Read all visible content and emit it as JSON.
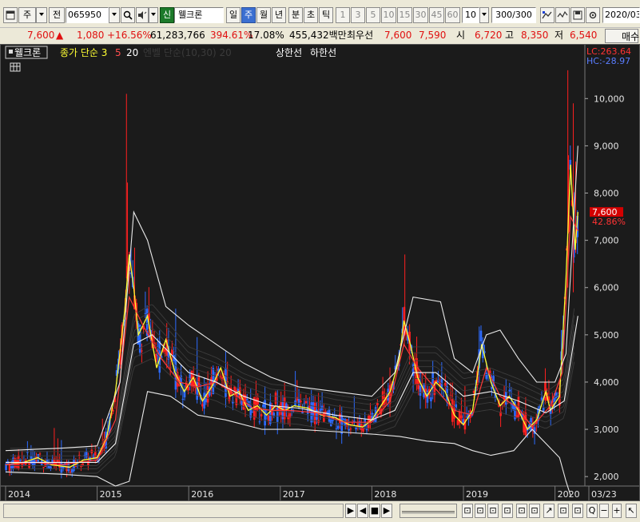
{
  "toolbar": {
    "market_label": "주",
    "prev_label": "전",
    "code": "065950",
    "stock_badge": "신",
    "stock_name": "웰크론",
    "period_day": "일",
    "period_week": "주",
    "period_month": "월",
    "period_year": "년",
    "period_minute": "분",
    "period_second": "초",
    "period_tick": "틱",
    "nums": [
      "1",
      "3",
      "5",
      "10",
      "15",
      "30",
      "45",
      "60"
    ],
    "interval": "10",
    "count": "300/300",
    "date": "2020/03"
  },
  "price": {
    "current": "7,600",
    "change_arrow": "▲",
    "change": "1,080",
    "change_pct": "+16.56%",
    "volume": "61,283,766",
    "volume_ratio": "394.61%",
    "turnover_pct": "17.08%",
    "amount": "455,432백만",
    "best_label": "최우선",
    "best_ask": "7,600",
    "best_bid": "7,590",
    "open_label": "시",
    "open": "6,720",
    "high_label": "고",
    "high": "8,350",
    "low_label": "저",
    "low": "6,540",
    "buy_label": "매수"
  },
  "legend": {
    "stock_name": "웰크론",
    "ma_label": "종가 단순 3",
    "ma_5": "5",
    "ma_20": "20",
    "faded": "엔벨 단순(10,30) 20",
    "upper_limit": "상한선",
    "lower_limit": "하한선"
  },
  "chart_data": {
    "type": "line",
    "title": "",
    "xlabel": "",
    "ylabel": "",
    "y_axis_ticks": [
      "10,000",
      "9,000",
      "8,000",
      "7,000",
      "6,000",
      "5,000",
      "4,000",
      "3,000",
      "2,000"
    ],
    "ylim": [
      1800,
      10800
    ],
    "x_axis_labels": [
      "2014",
      "2015",
      "2016",
      "2017",
      "2018",
      "2019",
      "2020",
      "03/23"
    ],
    "lc_label": "LC:263.64",
    "hc_label": "HC:-28.97",
    "current_price_label": "7,600",
    "current_pct_label": "42.86%",
    "series": [
      {
        "name": "종가 단순 3",
        "values": [
          [
            2014.0,
            2250
          ],
          [
            2014.2,
            2300
          ],
          [
            2014.35,
            2400
          ],
          [
            2014.5,
            2250
          ],
          [
            2014.7,
            2200
          ],
          [
            2014.85,
            2350
          ],
          [
            2015.0,
            2400
          ],
          [
            2015.1,
            2800
          ],
          [
            2015.2,
            3800
          ],
          [
            2015.3,
            5500
          ],
          [
            2015.35,
            6700
          ],
          [
            2015.4,
            6000
          ],
          [
            2015.45,
            5000
          ],
          [
            2015.55,
            5400
          ],
          [
            2015.65,
            4300
          ],
          [
            2015.75,
            4900
          ],
          [
            2015.85,
            4200
          ],
          [
            2015.95,
            3800
          ],
          [
            2016.05,
            4100
          ],
          [
            2016.15,
            3600
          ],
          [
            2016.25,
            3900
          ],
          [
            2016.35,
            4300
          ],
          [
            2016.45,
            3700
          ],
          [
            2016.55,
            3800
          ],
          [
            2016.65,
            3400
          ],
          [
            2016.75,
            3500
          ],
          [
            2016.85,
            3300
          ],
          [
            2016.95,
            3500
          ],
          [
            2017.05,
            3400
          ],
          [
            2017.15,
            3500
          ],
          [
            2017.3,
            3450
          ],
          [
            2017.45,
            3300
          ],
          [
            2017.6,
            3250
          ],
          [
            2017.75,
            3100
          ],
          [
            2017.9,
            3050
          ],
          [
            2018.0,
            3200
          ],
          [
            2018.1,
            3500
          ],
          [
            2018.2,
            3800
          ],
          [
            2018.3,
            4500
          ],
          [
            2018.35,
            5300
          ],
          [
            2018.42,
            4800
          ],
          [
            2018.5,
            4100
          ],
          [
            2018.6,
            3700
          ],
          [
            2018.7,
            4000
          ],
          [
            2018.8,
            3800
          ],
          [
            2018.9,
            3300
          ],
          [
            2019.0,
            3100
          ],
          [
            2019.1,
            3400
          ],
          [
            2019.2,
            4800
          ],
          [
            2019.3,
            4000
          ],
          [
            2019.4,
            3500
          ],
          [
            2019.5,
            3700
          ],
          [
            2019.6,
            3400
          ],
          [
            2019.7,
            3000
          ],
          [
            2019.8,
            3200
          ],
          [
            2019.9,
            3800
          ],
          [
            2019.95,
            3400
          ],
          [
            2020.05,
            3700
          ],
          [
            2020.12,
            6200
          ],
          [
            2020.17,
            8600
          ],
          [
            2020.22,
            6800
          ],
          [
            2020.25,
            7600
          ]
        ]
      },
      {
        "name": "5",
        "values": [
          [
            2014.0,
            2250
          ],
          [
            2014.3,
            2300
          ],
          [
            2014.6,
            2250
          ],
          [
            2015.0,
            2350
          ],
          [
            2015.2,
            3200
          ],
          [
            2015.35,
            5800
          ],
          [
            2015.5,
            5200
          ],
          [
            2015.7,
            4500
          ],
          [
            2015.9,
            4000
          ],
          [
            2016.1,
            3900
          ],
          [
            2016.3,
            4000
          ],
          [
            2016.5,
            3750
          ],
          [
            2016.7,
            3450
          ],
          [
            2016.9,
            3400
          ],
          [
            2017.1,
            3400
          ],
          [
            2017.4,
            3350
          ],
          [
            2017.7,
            3150
          ],
          [
            2018.0,
            3150
          ],
          [
            2018.2,
            3600
          ],
          [
            2018.35,
            4800
          ],
          [
            2018.5,
            4300
          ],
          [
            2018.7,
            3850
          ],
          [
            2018.9,
            3400
          ],
          [
            2019.1,
            3300
          ],
          [
            2019.25,
            4300
          ],
          [
            2019.4,
            3700
          ],
          [
            2019.6,
            3450
          ],
          [
            2019.75,
            3050
          ],
          [
            2019.95,
            3500
          ],
          [
            2020.08,
            4200
          ],
          [
            2020.17,
            7500
          ],
          [
            2020.25,
            7200
          ]
        ]
      },
      {
        "name": "20",
        "values": [
          [
            2014.0,
            2300
          ],
          [
            2014.5,
            2300
          ],
          [
            2015.0,
            2300
          ],
          [
            2015.2,
            2700
          ],
          [
            2015.4,
            4800
          ],
          [
            2015.6,
            5000
          ],
          [
            2015.8,
            4600
          ],
          [
            2016.0,
            4200
          ],
          [
            2016.3,
            4000
          ],
          [
            2016.6,
            3700
          ],
          [
            2016.9,
            3500
          ],
          [
            2017.2,
            3450
          ],
          [
            2017.6,
            3300
          ],
          [
            2018.0,
            3200
          ],
          [
            2018.25,
            3400
          ],
          [
            2018.45,
            4200
          ],
          [
            2018.7,
            4200
          ],
          [
            2019.0,
            3700
          ],
          [
            2019.3,
            3800
          ],
          [
            2019.6,
            3600
          ],
          [
            2019.9,
            3350
          ],
          [
            2020.1,
            3600
          ],
          [
            2020.25,
            5400
          ]
        ]
      },
      {
        "name": "상한선",
        "values": [
          [
            2014.0,
            2550
          ],
          [
            2014.6,
            2600
          ],
          [
            2015.0,
            2650
          ],
          [
            2015.25,
            4000
          ],
          [
            2015.4,
            7600
          ],
          [
            2015.55,
            7000
          ],
          [
            2015.75,
            5600
          ],
          [
            2016.0,
            5200
          ],
          [
            2016.3,
            4800
          ],
          [
            2016.6,
            4400
          ],
          [
            2016.9,
            4100
          ],
          [
            2017.2,
            3900
          ],
          [
            2017.6,
            3800
          ],
          [
            2018.0,
            3700
          ],
          [
            2018.25,
            4200
          ],
          [
            2018.45,
            5800
          ],
          [
            2018.75,
            5700
          ],
          [
            2018.9,
            4500
          ],
          [
            2019.1,
            4200
          ],
          [
            2019.25,
            5000
          ],
          [
            2019.4,
            5100
          ],
          [
            2019.6,
            4500
          ],
          [
            2019.8,
            4000
          ],
          [
            2020.0,
            4000
          ],
          [
            2020.12,
            4600
          ],
          [
            2020.25,
            9000
          ]
        ]
      },
      {
        "name": "하한선",
        "values": [
          [
            2014.0,
            2100
          ],
          [
            2014.6,
            2050
          ],
          [
            2015.0,
            2000
          ],
          [
            2015.2,
            1800
          ],
          [
            2015.35,
            1900
          ],
          [
            2015.55,
            3800
          ],
          [
            2015.8,
            3700
          ],
          [
            2016.1,
            3300
          ],
          [
            2016.4,
            3200
          ],
          [
            2016.8,
            3000
          ],
          [
            2017.2,
            3000
          ],
          [
            2017.6,
            2950
          ],
          [
            2018.0,
            2900
          ],
          [
            2018.3,
            2850
          ],
          [
            2018.6,
            2750
          ],
          [
            2018.9,
            2700
          ],
          [
            2019.1,
            2550
          ],
          [
            2019.3,
            2450
          ],
          [
            2019.55,
            2550
          ],
          [
            2019.75,
            3000
          ],
          [
            2019.9,
            2700
          ],
          [
            2020.05,
            2400
          ],
          [
            2020.12,
            1900
          ],
          [
            2020.17,
            1600
          ]
        ]
      }
    ]
  },
  "bottom": {
    "tools": [
      "▶",
      "◀",
      "■",
      "▶",
      "+",
      "Q",
      "-",
      "Q",
      "Q"
    ]
  }
}
